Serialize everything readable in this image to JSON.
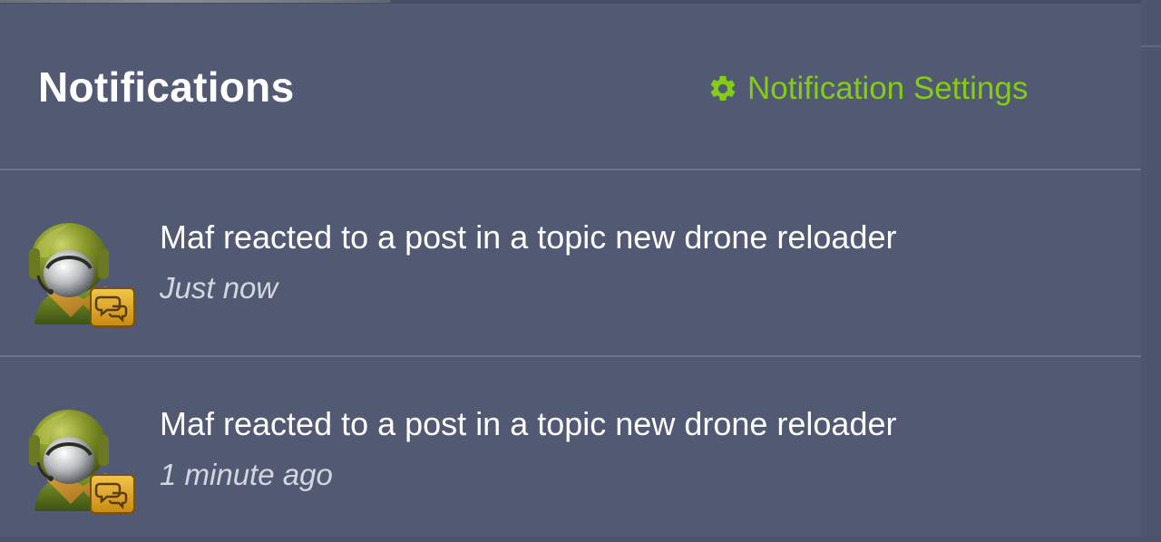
{
  "header": {
    "title": "Notifications",
    "settings_label": "Notification Settings",
    "settings_icon": "gear-icon"
  },
  "notifications": [
    {
      "actor": "Maf",
      "text": "Maf reacted to a post in a topic new drone reloader",
      "time": "Just now",
      "avatar_icon": "soldier-avatar-with-chat-badge"
    },
    {
      "actor": "Maf",
      "text": "Maf reacted to a post in a topic new drone reloader",
      "time": "1 minute ago",
      "avatar_icon": "soldier-avatar-with-chat-badge"
    }
  ],
  "colors": {
    "background": "#525a73",
    "accent": "#84cc16",
    "title": "#ffffff",
    "timestamp": "#d3d7e0",
    "divider": "#6d7488"
  }
}
